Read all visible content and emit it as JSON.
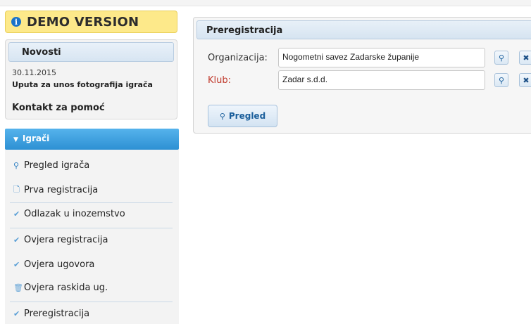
{
  "demo": {
    "label": "DEMO VERSION",
    "icon": "info-icon"
  },
  "news": {
    "title": "Novosti",
    "date": "30.11.2015",
    "item": "Uputa za unos fotografija igrača",
    "contact": "Kontakt za pomoć"
  },
  "menu": {
    "section": "Igrači",
    "items": [
      {
        "label": "Pregled igrača",
        "icon": "search-icon"
      },
      {
        "label": "Prva registracija",
        "icon": "document-icon"
      },
      {
        "label": "Odlazak u inozemstvo",
        "icon": "checkmark-icon"
      },
      {
        "label": "Ovjera registracija",
        "icon": "checkmark-icon"
      },
      {
        "label": "Ovjera ugovora",
        "icon": "checkmark-icon"
      },
      {
        "label": "Ovjera raskida ug.",
        "icon": "trash-icon"
      },
      {
        "label": "Preregistracija",
        "icon": "checkmark-icon"
      }
    ]
  },
  "panel": {
    "title": "Preregistracija",
    "org_label": "Organizacija:",
    "org_value": "Nogometni savez Zadarske županije",
    "club_label": "Klub:",
    "club_value": "Zadar s.d.d.",
    "button": "Pregled"
  },
  "colors": {
    "accent": "#2d90d3",
    "demo_bg": "#fde98a",
    "required_label": "#c0392b"
  }
}
